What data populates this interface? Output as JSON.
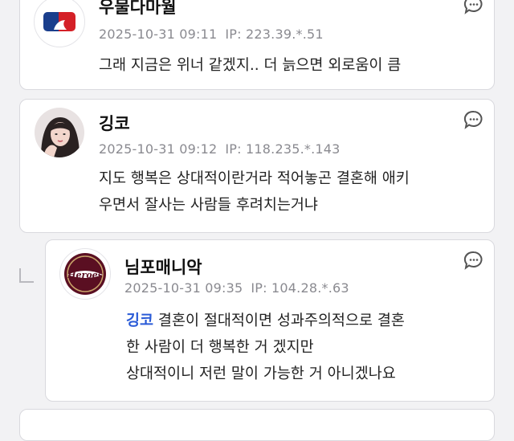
{
  "comments": [
    {
      "nickname": "우물다마월",
      "date": "2025-10-31 09:11",
      "ip": "IP: 223.39.*.51",
      "lines": [
        "그래 지금은 위너 같겠지.. 더 늙으면 외로움이 큼"
      ],
      "avatar_icon": "mlb-logo"
    },
    {
      "nickname": "깅코",
      "date": "2025-10-31 09:12",
      "ip": "IP: 118.235.*.143",
      "lines": [
        "지도 행복은 상대적이란거라 적어놓곤 결혼해 애키",
        "우면서 잘사는 사람들 후려치는거냐"
      ],
      "avatar_icon": "profile-photo"
    }
  ],
  "reply": {
    "nickname": "님포매니악",
    "date": "2025-10-31 09:35",
    "ip": "IP: 104.28.*.63",
    "mention": "깅코",
    "line1_rest": " 결혼이 절대적이면 성과주의적으로 결혼",
    "line2": "한 사람이 더 행복한 거 겠지만",
    "line3": "상대적이니 저런 말이 가능한 거 아니겠나요",
    "avatar_icon": "heroes-logo",
    "logo_text": "Heroes"
  },
  "colors": {
    "mention": "#2a5bd7",
    "meta": "#8a8a90",
    "card_border": "#d9d9de"
  }
}
